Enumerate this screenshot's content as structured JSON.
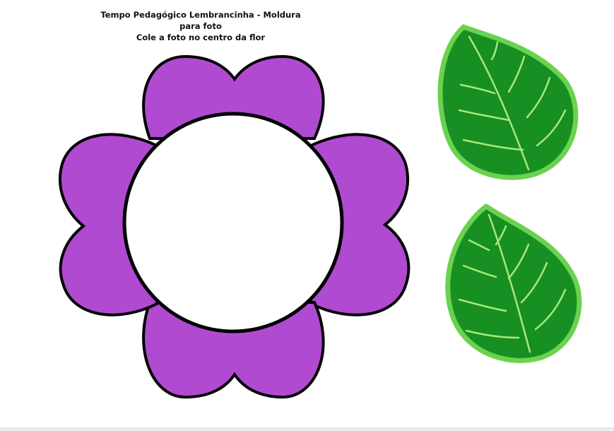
{
  "header": {
    "title": "Tempo Pedagógico Lembrancinha - Moldura para foto",
    "subtitle": "Cole a foto no centro da flor"
  },
  "colors": {
    "petal_fill": "#b04ad1",
    "outline": "#000000",
    "center_fill": "#ffffff",
    "leaf_fill": "#178f22",
    "leaf_border": "#6ad24e",
    "leaf_vein": "#a8e87a"
  },
  "icons": {
    "flower": "flower-frame",
    "leaf": "leaf"
  }
}
